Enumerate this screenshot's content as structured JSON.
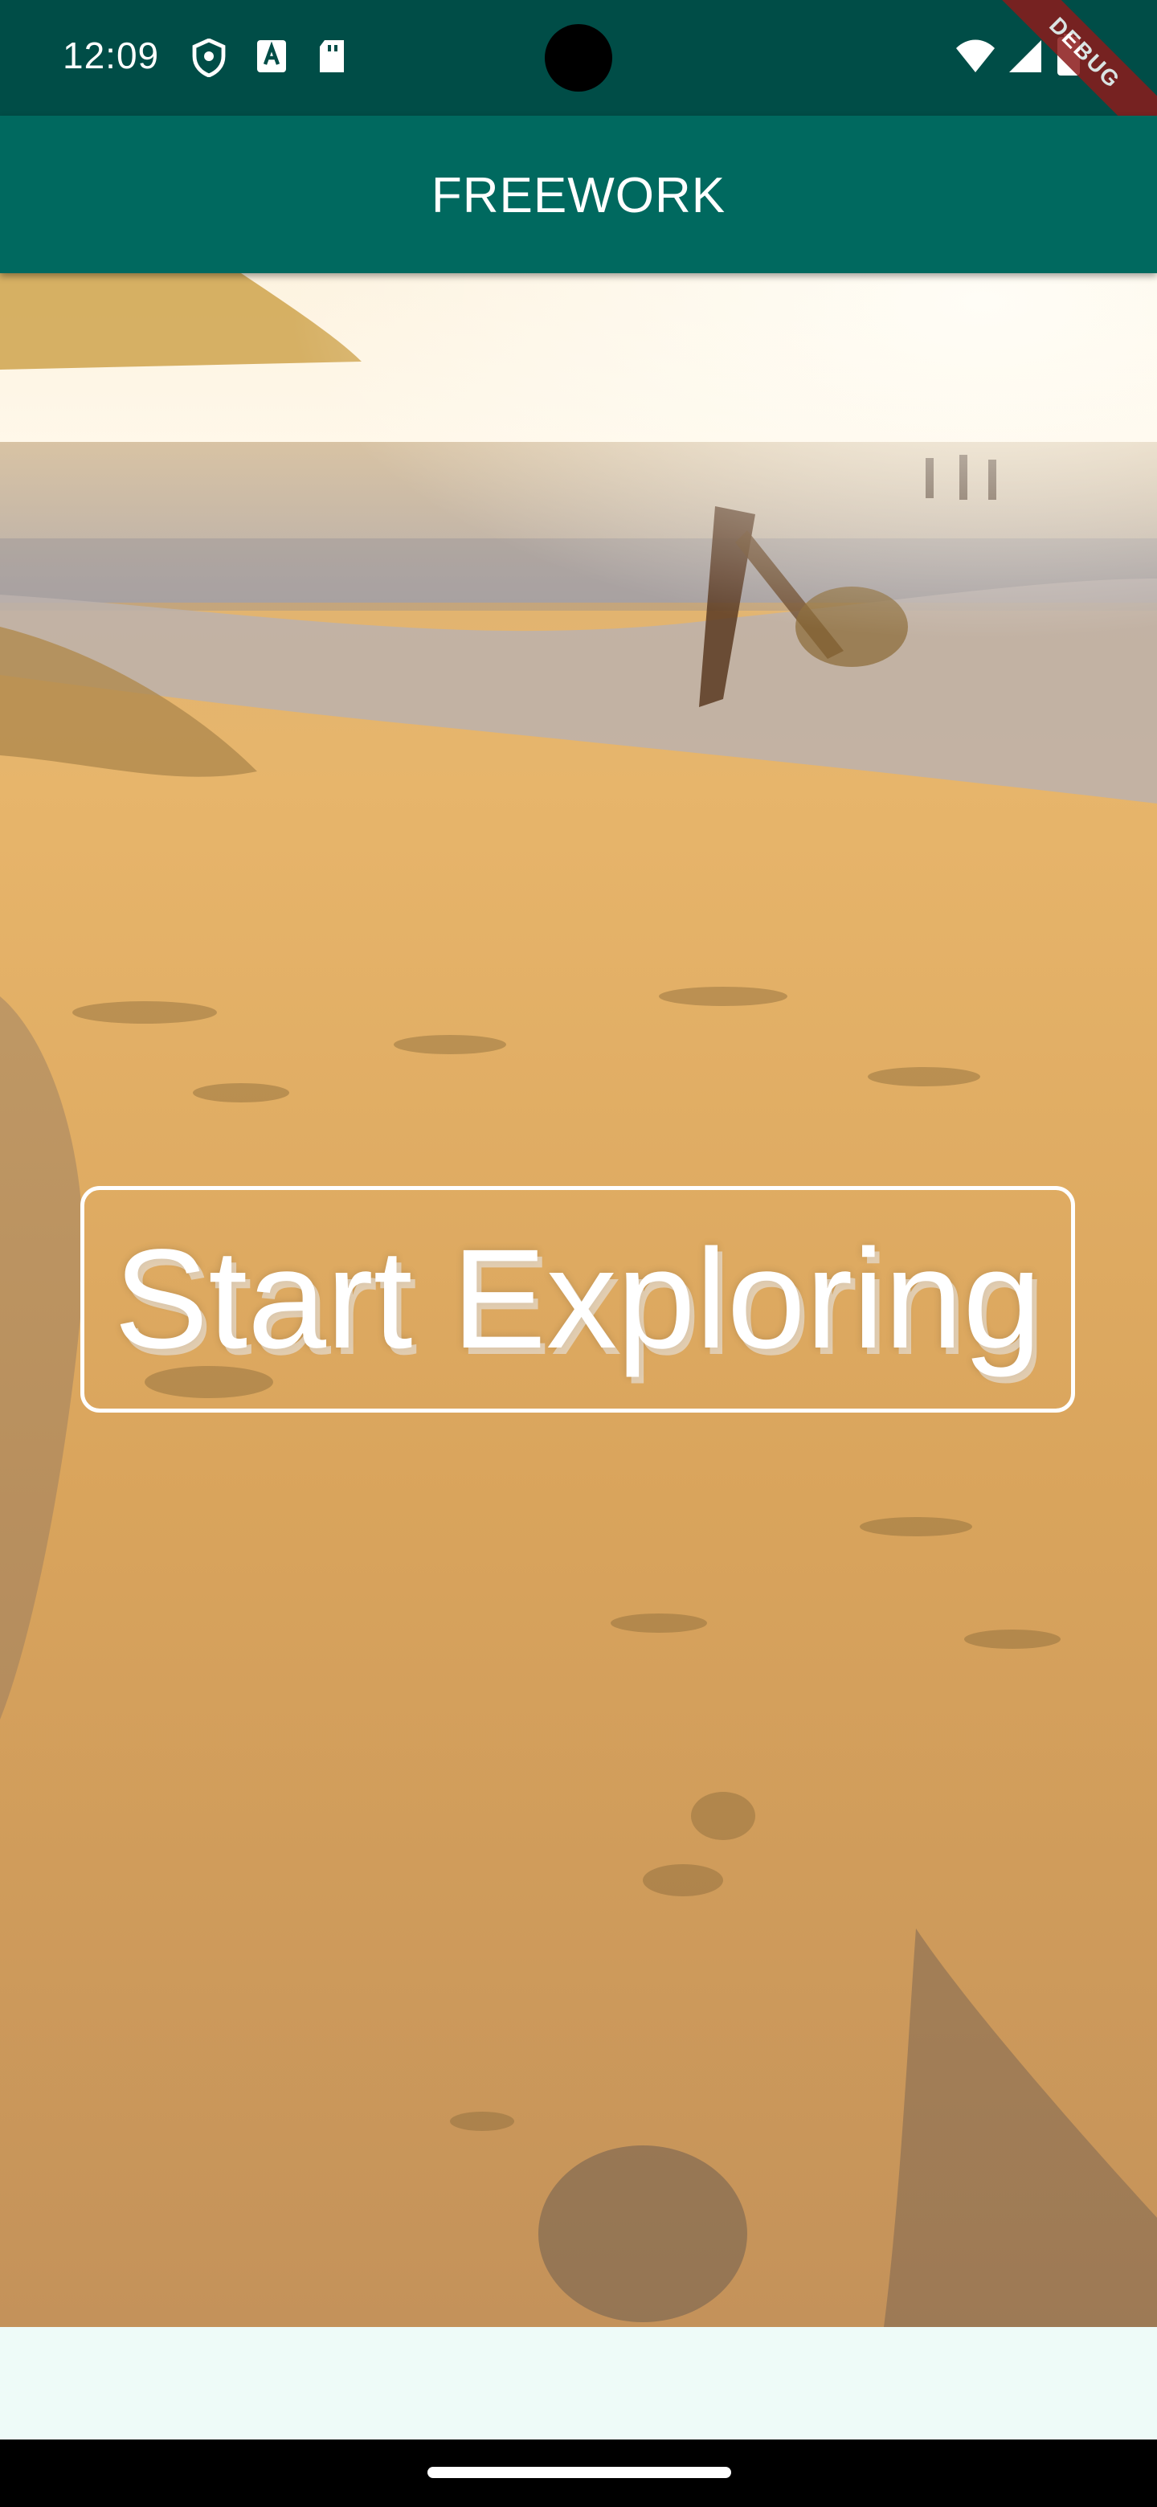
{
  "status_bar": {
    "time": "12:09",
    "left_icons": [
      "shield-icon",
      "text-a-icon",
      "sd-card-icon"
    ],
    "right_icons": [
      "wifi-icon",
      "cell-signal-icon",
      "battery-icon"
    ],
    "debug_banner": "DEBUG"
  },
  "app_bar": {
    "title": "FREEWORK",
    "color": "#00695f"
  },
  "hero": {
    "description_icon": "beach-dunes-photo"
  },
  "cta": {
    "label": "Start Exploring"
  },
  "colors": {
    "status_bar": "#004d47",
    "app_bar": "#00695f",
    "bottom_panel": "#eefbf8"
  }
}
